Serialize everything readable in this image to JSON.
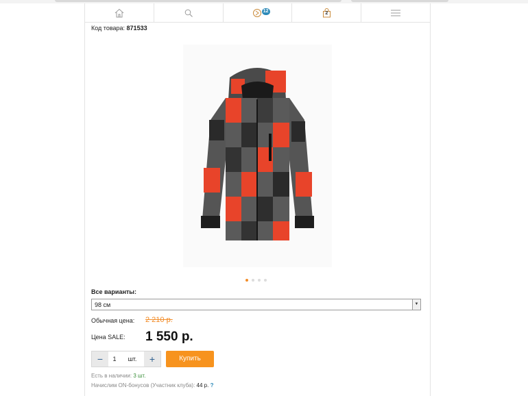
{
  "nav": {
    "compare_badge": "12",
    "cart_count": "2"
  },
  "product": {
    "sku_label": "Код товара:",
    "sku_value": "871533",
    "variants_label": "Все варианты:",
    "selected_variant": "98 см",
    "regular_price_label": "Обычная цена:",
    "regular_price": "2 210 р.",
    "sale_price_label": "Цена SALE:",
    "sale_price": "1 550 р.",
    "quantity": "1",
    "quantity_unit": "шт.",
    "buy_label": "Купить",
    "stock_label": "Есть в наличии:",
    "stock_value": "3 шт.",
    "bonus_label": "Начислим ON-бонусов (Участник клуба):",
    "bonus_value": "44 р.",
    "bonus_help": "?"
  },
  "colors": {
    "accent": "#f7931e",
    "badge": "#2d8ab8",
    "jacket_red": "#e8442a",
    "jacket_grey": "#555555"
  },
  "icons": [
    "home-icon",
    "search-icon",
    "compare-icon",
    "cart-icon",
    "menu-icon",
    "minus-icon",
    "plus-icon"
  ]
}
